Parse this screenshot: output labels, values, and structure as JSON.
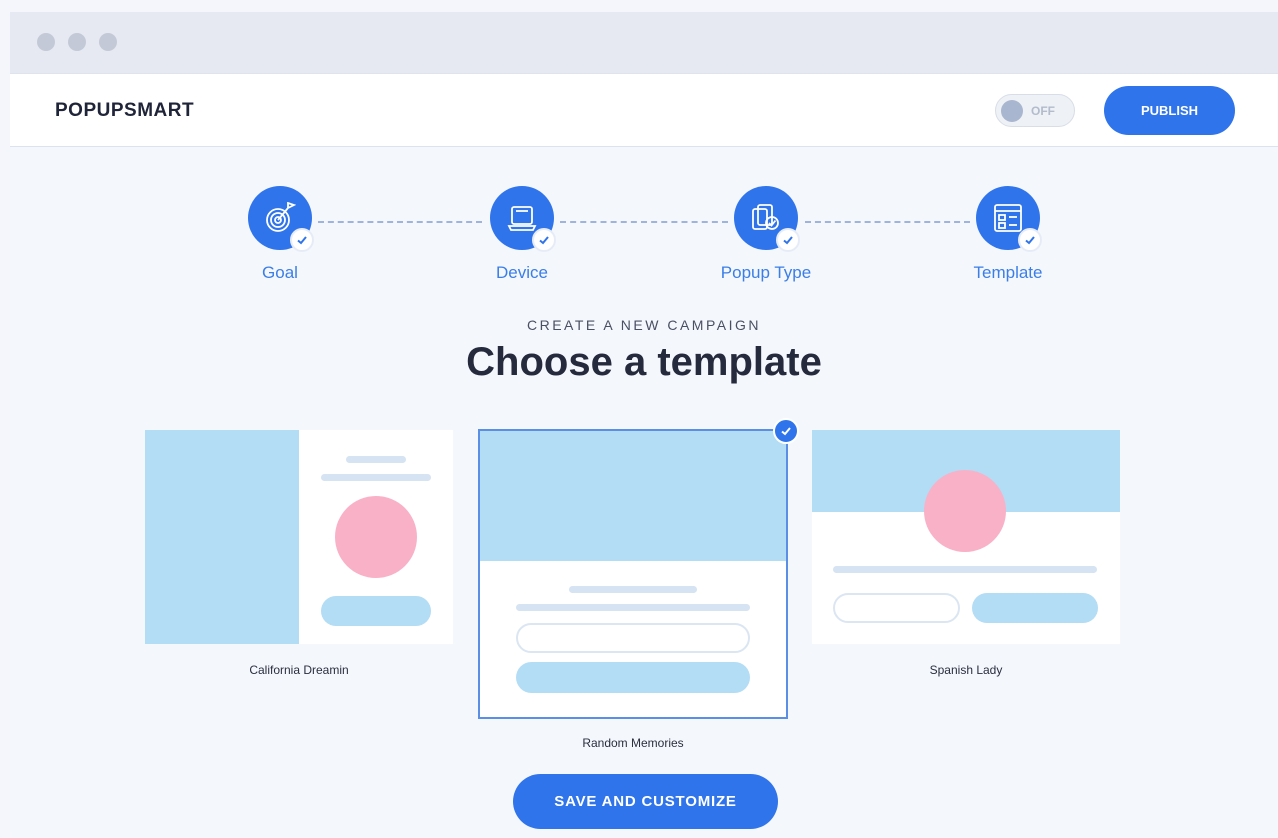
{
  "brand": {
    "name": "POPUPSMART"
  },
  "header": {
    "toggle_label": "OFF",
    "publish_label": "PUBLISH"
  },
  "steps": [
    {
      "label": "Goal",
      "icon": "target-icon",
      "completed": true
    },
    {
      "label": "Device",
      "icon": "monitor-icon",
      "completed": true
    },
    {
      "label": "Popup Type",
      "icon": "popup-type-icon",
      "completed": true
    },
    {
      "label": "Template",
      "icon": "template-icon",
      "completed": true
    }
  ],
  "main": {
    "subtitle": "CREATE A NEW CAMPAIGN",
    "title": "Choose a template"
  },
  "templates": [
    {
      "name": "California Dreamin",
      "selected": false
    },
    {
      "name": "Random Memories",
      "selected": true
    },
    {
      "name": "Spanish Lady",
      "selected": false
    }
  ],
  "actions": {
    "save_label": "SAVE AND CUSTOMIZE"
  },
  "colors": {
    "accent": "#2f74eb",
    "preview_blue": "#b3dcf5",
    "preview_pink": "#f9b1c8"
  }
}
